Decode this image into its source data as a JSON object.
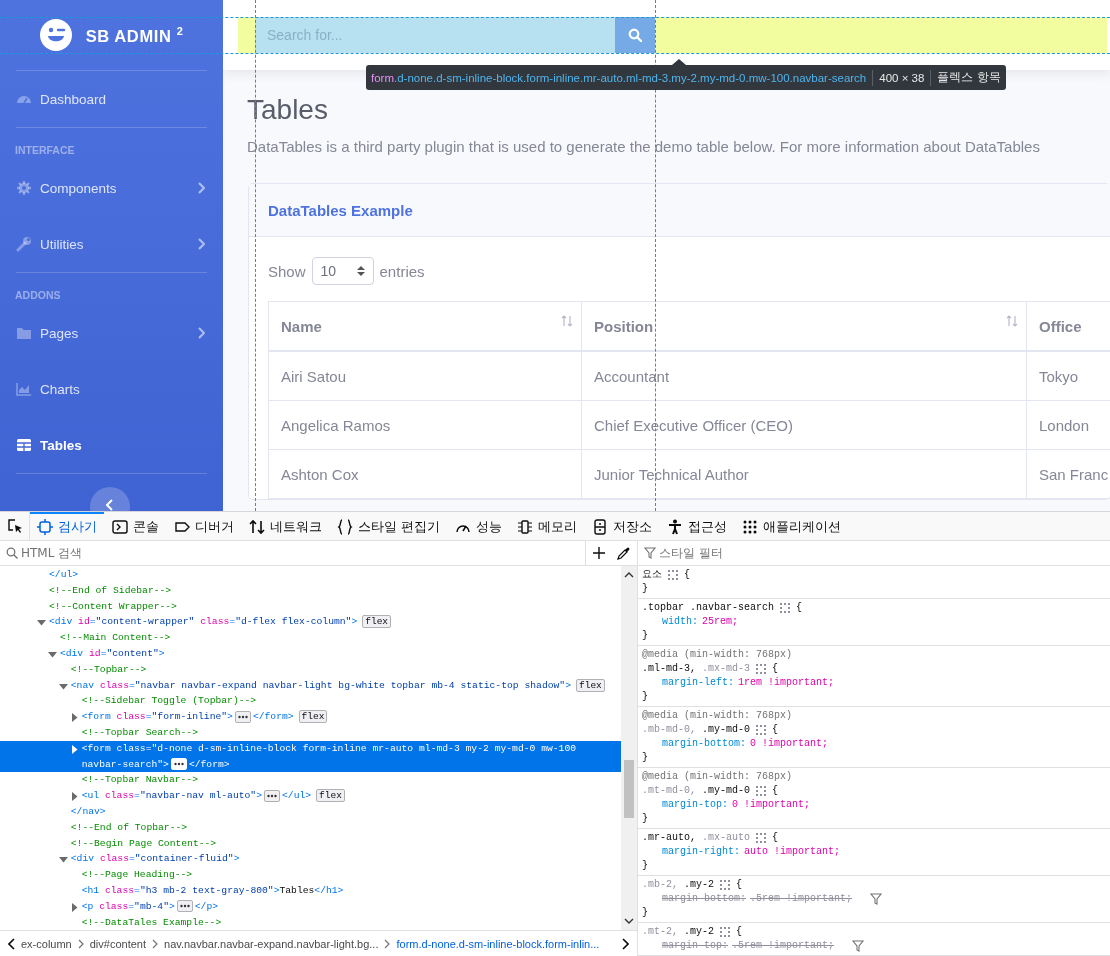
{
  "sidebar": {
    "brand": "SB ADMIN $^{2}$",
    "items": [
      {
        "kind": "divider"
      },
      {
        "kind": "link",
        "label": "Dashboard",
        "expandable": false,
        "selected": false
      },
      {
        "kind": "divider"
      },
      {
        "kind": "heading",
        "label": "INTERFACE"
      },
      {
        "kind": "link",
        "label": "Components",
        "expandable": true,
        "selected": false
      },
      {
        "kind": "link",
        "label": "Utilities",
        "expandable": true,
        "selected": false
      },
      {
        "kind": "divider"
      },
      {
        "kind": "heading",
        "label": "ADDONS"
      },
      {
        "kind": "link",
        "label": "Pages",
        "expandable": true,
        "selected": false
      },
      {
        "kind": "link",
        "label": "Charts",
        "expandable": false,
        "selected": false
      },
      {
        "kind": "link",
        "label": "Tables",
        "expandable": false,
        "selected": true
      },
      {
        "kind": "divider"
      }
    ]
  },
  "topbar": {
    "search": {
      "placeholder": "Search for..."
    }
  },
  "inspector_tooltip": {
    "tag": "form",
    "classes": ".d-none.d-sm-inline-block.form-inline.mr-auto.ml-md-3.my-2.my-md-0.mw-100.navbar-search",
    "size": "400 × 38",
    "role": "플렉스 항목"
  },
  "page": {
    "heading": "Tables",
    "description": "DataTables is a third party plugin that is used to generate the demo table below. For more information about DataTables",
    "card": {
      "title": "DataTables Example",
      "length_control": {
        "before": "Show",
        "value": "10",
        "after": "entries"
      },
      "table": {
        "columns": [
          {
            "label": "Name",
            "sortable": true
          },
          {
            "label": "Position",
            "sortable": true
          },
          {
            "label": "Office",
            "sortable": false
          }
        ],
        "rows": [
          [
            "Airi Satou",
            "Accountant",
            "Tokyo"
          ],
          [
            "Angelica Ramos",
            "Chief Executive Officer (CEO)",
            "London"
          ],
          [
            "Ashton Cox",
            "Junior Technical Author",
            "San Franc"
          ]
        ]
      }
    }
  },
  "devtools": {
    "tabs": [
      {
        "label": "검사기",
        "selected": true
      },
      {
        "label": "콘솔",
        "selected": false
      },
      {
        "label": "디버거",
        "selected": false
      },
      {
        "label": "네트워크",
        "selected": false
      },
      {
        "label": "스타일 편집기",
        "selected": false
      },
      {
        "label": "성능",
        "selected": false
      },
      {
        "label": "메모리",
        "selected": false
      },
      {
        "label": "저장소",
        "selected": false
      },
      {
        "label": "접근성",
        "selected": false
      },
      {
        "label": "애플리케이션",
        "selected": false
      }
    ],
    "html_search": {
      "placeholder": "HTML 검색"
    },
    "style_filter": {
      "placeholder": "스타일 필터"
    },
    "html_tree": [
      {
        "kind": "text",
        "selected": false,
        "tokens": [
          {
            "kind": "tag",
            "text": "</ul>"
          }
        ]
      },
      {
        "kind": "comment",
        "selected": false,
        "tokens": [
          {
            "kind": "cm",
            "text": "<!--End of Sidebar-->"
          }
        ]
      },
      {
        "kind": "comment",
        "selected": false,
        "tokens": [
          {
            "kind": "cm",
            "text": "<!--Content Wrapper-->"
          }
        ]
      },
      {
        "kind": "element",
        "selected": false,
        "expanded": true,
        "badge": "flex",
        "tokens": [
          {
            "kind": "tag",
            "text": "<div"
          },
          {
            "kind": "attr",
            "text": " id"
          },
          {
            "kind": "tag",
            "text": "="
          },
          {
            "kind": "val",
            "text": "\"content-wrapper\""
          },
          {
            "kind": "attr",
            "text": " class"
          },
          {
            "kind": "tag",
            "text": "="
          },
          {
            "kind": "val",
            "text": "\"d-flex flex-column\""
          },
          {
            "kind": "tag",
            "text": ">"
          }
        ],
        "children": [
          {
            "kind": "comment",
            "selected": false,
            "tokens": [
              {
                "kind": "cm",
                "text": "<!--Main Content-->"
              }
            ]
          },
          {
            "kind": "element",
            "selected": false,
            "expanded": true,
            "tokens": [
              {
                "kind": "tag",
                "text": "<div"
              },
              {
                "kind": "attr",
                "text": " id"
              },
              {
                "kind": "tag",
                "text": "="
              },
              {
                "kind": "val",
                "text": "\"content\""
              },
              {
                "kind": "tag",
                "text": ">"
              }
            ],
            "children": [
              {
                "kind": "comment",
                "selected": false,
                "tokens": [
                  {
                    "kind": "cm",
                    "text": "<!--Topbar-->"
                  }
                ]
              },
              {
                "kind": "element",
                "selected": false,
                "expanded": true,
                "badge": "flex",
                "tokens": [
                  {
                    "kind": "tag",
                    "text": "<nav"
                  },
                  {
                    "kind": "attr",
                    "text": " class"
                  },
                  {
                    "kind": "tag",
                    "text": "="
                  },
                  {
                    "kind": "val",
                    "text": "\"navbar navbar-expand navbar-light bg-white topbar mb-4 static-top shadow\""
                  },
                  {
                    "kind": "tag",
                    "text": ">"
                  }
                ],
                "children": [
                  {
                    "kind": "comment",
                    "selected": false,
                    "tokens": [
                      {
                        "kind": "cm",
                        "text": "<!--Sidebar Toggle (Topbar)-->"
                      }
                    ]
                  },
                  {
                    "kind": "element",
                    "selected": false,
                    "expanded": false,
                    "badge": "flex",
                    "tokens": [
                      {
                        "kind": "tag",
                        "text": "<form"
                      },
                      {
                        "kind": "attr",
                        "text": " class"
                      },
                      {
                        "kind": "tag",
                        "text": "="
                      },
                      {
                        "kind": "val",
                        "text": "\"form-inline\""
                      },
                      {
                        "kind": "tag",
                        "text": ">"
                      }
                    ],
                    "tail": [
                      {
                        "kind": "tag",
                        "text": "</form>"
                      }
                    ]
                  },
                  {
                    "kind": "comment",
                    "selected": false,
                    "tokens": [
                      {
                        "kind": "cm",
                        "text": "<!--Topbar Search-->"
                      }
                    ]
                  },
                  {
                    "kind": "element",
                    "selected": true,
                    "expanded": false,
                    "tokens": [
                      {
                        "kind": "tag",
                        "text": "<form"
                      },
                      {
                        "kind": "attr",
                        "text": " class"
                      },
                      {
                        "kind": "tag",
                        "text": "="
                      },
                      {
                        "kind": "val",
                        "text": "\"d-none d-sm-inline-block form-inline mr-auto ml-md-3 my-2 my-md-0 mw-100 navbar-search\""
                      },
                      {
                        "kind": "tag",
                        "text": ">"
                      }
                    ],
                    "tail": [
                      {
                        "kind": "tag",
                        "text": "</form>"
                      }
                    ]
                  },
                  {
                    "kind": "comment",
                    "selected": false,
                    "tokens": [
                      {
                        "kind": "cm",
                        "text": "<!--Topbar Navbar-->"
                      }
                    ]
                  },
                  {
                    "kind": "element",
                    "selected": false,
                    "expanded": false,
                    "badge": "flex",
                    "tokens": [
                      {
                        "kind": "tag",
                        "text": "<ul"
                      },
                      {
                        "kind": "attr",
                        "text": " class"
                      },
                      {
                        "kind": "tag",
                        "text": "="
                      },
                      {
                        "kind": "val",
                        "text": "\"navbar-nav ml-auto\""
                      },
                      {
                        "kind": "tag",
                        "text": ">"
                      }
                    ],
                    "tail": [
                      {
                        "kind": "tag",
                        "text": "</ul>"
                      }
                    ]
                  }
                ]
              },
              {
                "kind": "text",
                "selected": false,
                "tokens": [
                  {
                    "kind": "tag",
                    "text": "</nav>"
                  }
                ]
              },
              {
                "kind": "comment",
                "selected": false,
                "tokens": [
                  {
                    "kind": "cm",
                    "text": "<!--End of Topbar-->"
                  }
                ]
              },
              {
                "kind": "comment",
                "selected": false,
                "tokens": [
                  {
                    "kind": "cm",
                    "text": "<!--Begin Page Content-->"
                  }
                ]
              },
              {
                "kind": "element",
                "selected": false,
                "expanded": true,
                "tokens": [
                  {
                    "kind": "tag",
                    "text": "<div"
                  },
                  {
                    "kind": "attr",
                    "text": " class"
                  },
                  {
                    "kind": "tag",
                    "text": "="
                  },
                  {
                    "kind": "val",
                    "text": "\"container-fluid\""
                  },
                  {
                    "kind": "tag",
                    "text": ">"
                  }
                ],
                "children": [
                  {
                    "kind": "comment",
                    "selected": false,
                    "tokens": [
                      {
                        "kind": "cm",
                        "text": "<!--Page Heading-->"
                      }
                    ]
                  },
                  {
                    "kind": "text",
                    "selected": false,
                    "tokens": [
                      {
                        "kind": "tag",
                        "text": "<h1"
                      },
                      {
                        "kind": "attr",
                        "text": " class"
                      },
                      {
                        "kind": "tag",
                        "text": "="
                      },
                      {
                        "kind": "val",
                        "text": "\"h3 mb-2 text-gray-800\""
                      },
                      {
                        "kind": "tag",
                        "text": ">"
                      },
                      {
                        "kind": "txt",
                        "text": "Tables"
                      },
                      {
                        "kind": "tag",
                        "text": "</h1>"
                      }
                    ]
                  },
                  {
                    "kind": "element",
                    "selected": false,
                    "expanded": false,
                    "tokens": [
                      {
                        "kind": "tag",
                        "text": "<p"
                      },
                      {
                        "kind": "attr",
                        "text": " class"
                      },
                      {
                        "kind": "tag",
                        "text": "="
                      },
                      {
                        "kind": "val",
                        "text": "\"mb-4\""
                      },
                      {
                        "kind": "tag",
                        "text": ">"
                      }
                    ],
                    "tail": [
                      {
                        "kind": "tag",
                        "text": "</p>"
                      }
                    ]
                  },
                  {
                    "kind": "comment",
                    "selected": false,
                    "tokens": [
                      {
                        "kind": "cm",
                        "text": "<!--DataTales Example-->"
                      }
                    ]
                  }
                ]
              }
            ]
          }
        ]
      }
    ],
    "breadcrumbs": [
      {
        "text": "ex-column",
        "selected": false
      },
      {
        "text": "div#content",
        "selected": false
      },
      {
        "text": "nav.navbar.navbar-expand.navbar-light.bg...",
        "selected": false
      },
      {
        "text": "form.d-none.d-sm-inline-block.form-inlin...",
        "selected": true
      }
    ],
    "rules": [
      {
        "selectors": [
          {
            "text": "요소",
            "matched": true
          }
        ],
        "open": "{",
        "close": "}"
      },
      {
        "selectors": [
          {
            "text": ".topbar .navbar-search",
            "matched": true
          }
        ],
        "open": "{",
        "decls": [
          {
            "prop": "width:",
            "value": "25rem;",
            "overridden": false
          }
        ],
        "close": "}"
      },
      {
        "media": "@media (min-width: 768px)",
        "selectors": [
          {
            "text": ".ml-md-3,",
            "matched": true
          },
          {
            "text": ".mx-md-3",
            "matched": false
          }
        ],
        "open": "{",
        "decls": [
          {
            "prop": "margin-left:",
            "value": "1rem !important;",
            "overridden": false
          }
        ],
        "close": "}"
      },
      {
        "media": "@media (min-width: 768px)",
        "selectors": [
          {
            "text": ".mb-md-0,",
            "matched": false
          },
          {
            "text": ".my-md-0",
            "matched": true
          }
        ],
        "open": "{",
        "decls": [
          {
            "prop": "margin-bottom:",
            "value": "0 !important;",
            "overridden": false
          }
        ],
        "close": "}"
      },
      {
        "media": "@media (min-width: 768px)",
        "selectors": [
          {
            "text": ".mt-md-0,",
            "matched": false
          },
          {
            "text": ".my-md-0",
            "matched": true
          }
        ],
        "open": "{",
        "decls": [
          {
            "prop": "margin-top:",
            "value": "0 !important;",
            "overridden": false
          }
        ],
        "close": "}"
      },
      {
        "selectors": [
          {
            "text": ".mr-auto,",
            "matched": true
          },
          {
            "text": ".mx-auto",
            "matched": false
          }
        ],
        "open": "{",
        "decls": [
          {
            "prop": "margin-right:",
            "value": "auto !important;",
            "overridden": false
          }
        ],
        "close": "}"
      },
      {
        "selectors": [
          {
            "text": ".mb-2,",
            "matched": false
          },
          {
            "text": ".my-2",
            "matched": true
          }
        ],
        "open": "{",
        "decls": [
          {
            "prop": "margin-bottom:",
            "value": ".5rem !important;",
            "overridden": true
          }
        ],
        "close": "}"
      },
      {
        "selectors": [
          {
            "text": ".mt-2,",
            "matched": false
          },
          {
            "text": ".my-2",
            "matched": true
          }
        ],
        "open": "{",
        "decls": [
          {
            "prop": "margin-top:",
            "value": ".5rem !important;",
            "overridden": true
          }
        ]
      }
    ]
  }
}
